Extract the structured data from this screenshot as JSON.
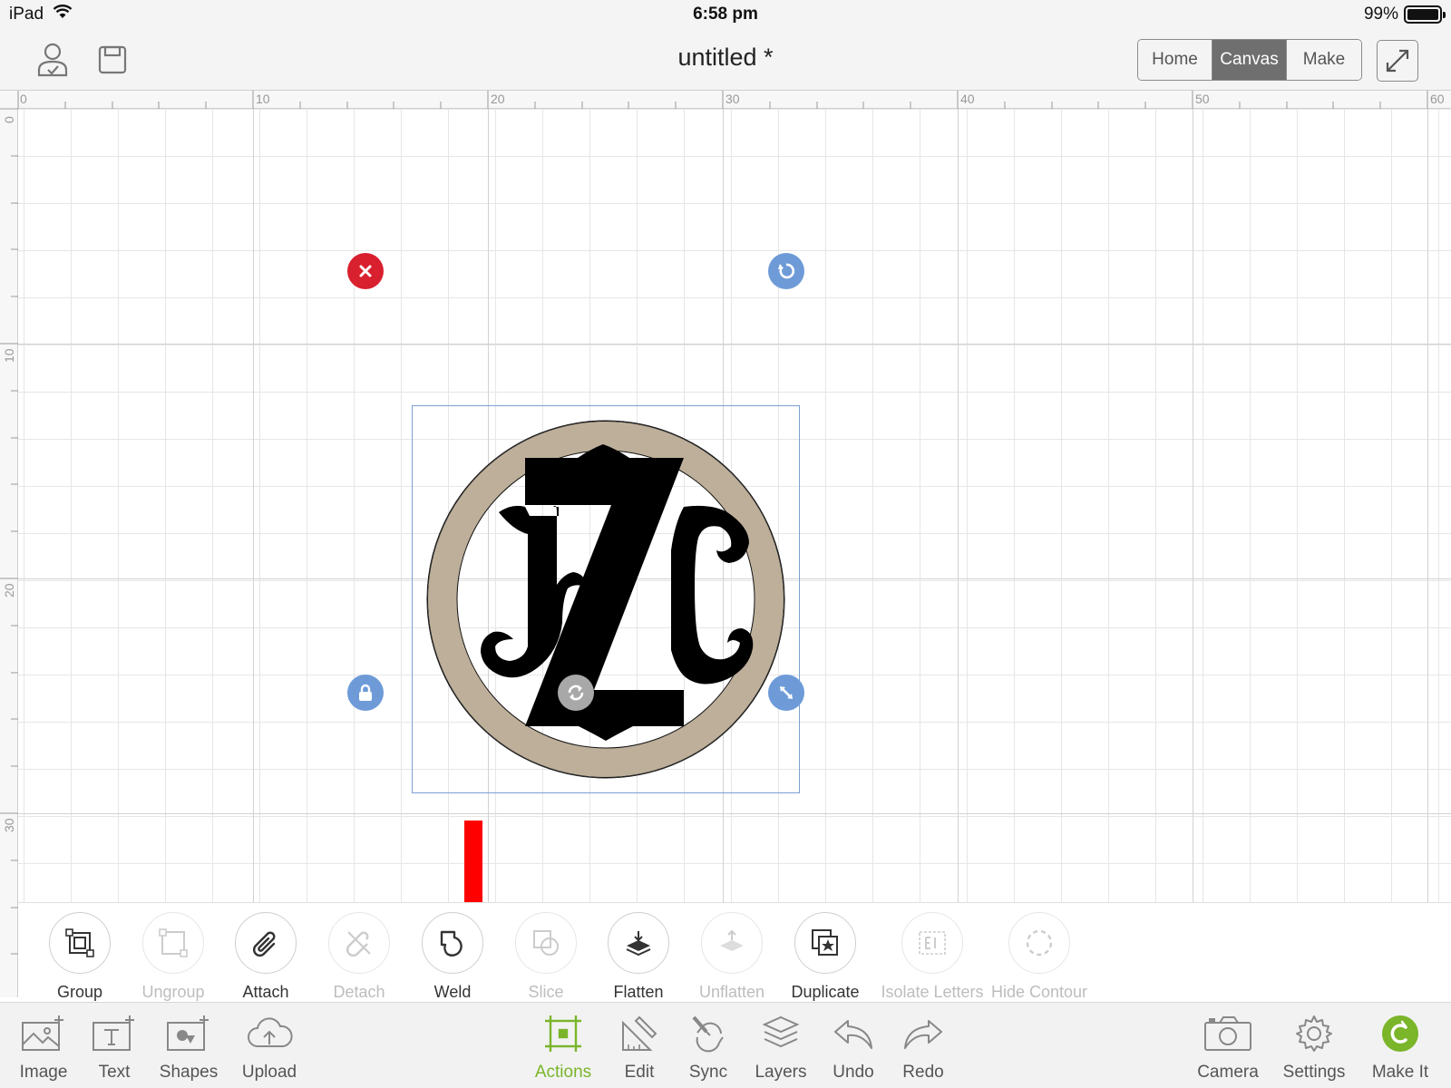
{
  "status_bar": {
    "device": "iPad",
    "time": "6:58 pm",
    "battery_percent": "99%",
    "battery_level": 0.99
  },
  "header": {
    "title": "untitled *",
    "tabs": [
      {
        "label": "Home",
        "active": false
      },
      {
        "label": "Canvas",
        "active": true
      },
      {
        "label": "Make",
        "active": false
      }
    ]
  },
  "rulers": {
    "top": [
      "0",
      "10",
      "20",
      "30",
      "40",
      "50",
      "60"
    ],
    "left": [
      "0",
      "10",
      "20",
      "30"
    ]
  },
  "design": {
    "letters": "JZC",
    "ring_color": "#bdaf9a",
    "letter_color": "#000000"
  },
  "annotation": {
    "arrow_color": "#ff0000"
  },
  "actions": [
    {
      "label": "Group",
      "enabled": true
    },
    {
      "label": "Ungroup",
      "enabled": false
    },
    {
      "label": "Attach",
      "enabled": true
    },
    {
      "label": "Detach",
      "enabled": false
    },
    {
      "label": "Weld",
      "enabled": true
    },
    {
      "label": "Slice",
      "enabled": false
    },
    {
      "label": "Flatten",
      "enabled": true
    },
    {
      "label": "Unflatten",
      "enabled": false
    },
    {
      "label": "Duplicate",
      "enabled": true
    },
    {
      "label": "Isolate Letters",
      "enabled": false
    },
    {
      "label": "Hide Contour",
      "enabled": false
    }
  ],
  "toolbar": {
    "left": [
      {
        "label": "Image",
        "icon": "image-add-icon"
      },
      {
        "label": "Text",
        "icon": "text-add-icon"
      },
      {
        "label": "Shapes",
        "icon": "shapes-add-icon"
      },
      {
        "label": "Upload",
        "icon": "cloud-upload-icon"
      }
    ],
    "center": [
      {
        "label": "Actions",
        "icon": "actions-icon",
        "active": true
      },
      {
        "label": "Edit",
        "icon": "edit-ruler-icon"
      },
      {
        "label": "Sync",
        "icon": "sync-icon"
      },
      {
        "label": "Layers",
        "icon": "layers-icon"
      },
      {
        "label": "Undo",
        "icon": "undo-icon"
      },
      {
        "label": "Redo",
        "icon": "redo-icon"
      }
    ],
    "right": [
      {
        "label": "Camera",
        "icon": "camera-icon"
      },
      {
        "label": "Settings",
        "icon": "gear-icon"
      },
      {
        "label": "Make It",
        "icon": "make-it-icon"
      }
    ]
  },
  "colors": {
    "accent_green": "#7ab52a",
    "handle_red": "#d9202f",
    "handle_blue": "#6e9bd8"
  }
}
